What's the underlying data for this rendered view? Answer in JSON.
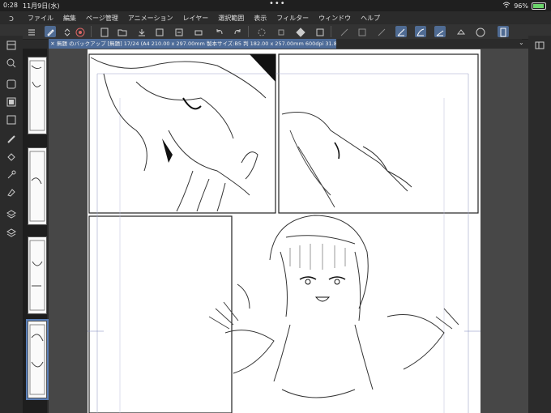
{
  "status": {
    "time": "0:28",
    "date": "11月9日(水)",
    "battery": "96%"
  },
  "menu": {
    "items": [
      "ファイル",
      "編集",
      "ページ管理",
      "アニメーション",
      "レイヤー",
      "選択範囲",
      "表示",
      "フィルター",
      "ウィンドウ",
      "ヘルプ"
    ]
  },
  "tab": {
    "title": "無題 のバックアップ [無題] 17/24 (A4 210.00 x 297.00mm 製本サイズ:B5 判 182.00 x 257.00mm 600dpi 31.8%)"
  },
  "colors": {
    "accent": "#4f6b93",
    "tab": "#4d6b98",
    "bg": "#2b2b2b",
    "canvas": "#474747"
  }
}
